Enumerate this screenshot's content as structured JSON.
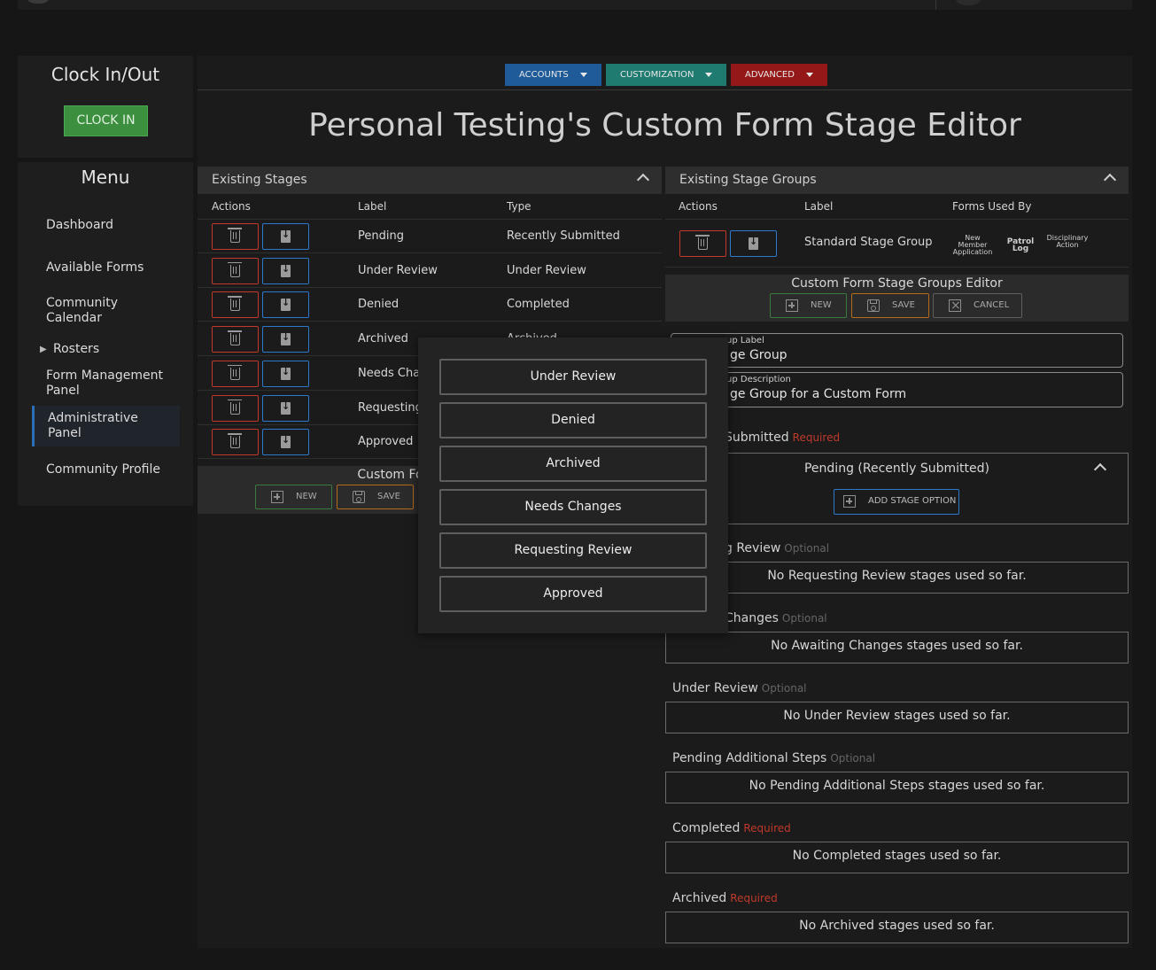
{
  "clock": {
    "title": "Clock In/Out",
    "button": "CLOCK IN"
  },
  "menu": {
    "title": "Menu",
    "items": [
      "Dashboard",
      "Available Forms",
      "Community Calendar",
      "Rosters",
      "Form Management Panel",
      "Administrative Panel",
      "Community Profile"
    ],
    "active": "Administrative Panel"
  },
  "nav": {
    "accounts": "ACCOUNTS",
    "customization": "CUSTOMIZATION",
    "advanced": "ADVANCED"
  },
  "page_title": "Personal Testing's Custom Form Stage Editor",
  "stages": {
    "title": "Existing Stages",
    "columns": [
      "Actions",
      "Label",
      "Type"
    ],
    "rows": [
      {
        "label": "Pending",
        "type": "Recently Submitted"
      },
      {
        "label": "Under Review",
        "type": "Under Review"
      },
      {
        "label": "Denied",
        "type": "Completed"
      },
      {
        "label": "Archived",
        "type": "Archived"
      },
      {
        "label": "Needs Chan",
        "type": ""
      },
      {
        "label": "Requesting",
        "type": ""
      },
      {
        "label": "Approved",
        "type": ""
      }
    ],
    "editor_title": "Custom Fo",
    "new_label": "NEW",
    "save_label": "SAVE"
  },
  "groups": {
    "title": "Existing Stage Groups",
    "columns": [
      "Actions",
      "Label",
      "Forms Used By"
    ],
    "row": {
      "label": "Standard Stage Group",
      "forms": [
        "New Member Application",
        "Patrol Log",
        "Disciplinary Action"
      ]
    },
    "editor_title": "Custom Form Stage Groups Editor",
    "new_label": "NEW",
    "save_label": "SAVE",
    "cancel_label": "CANCEL",
    "label_field": {
      "label": "up Label",
      "value": "ge Group"
    },
    "desc_field": {
      "label": "up Description",
      "value": "ge Group for a Custom Form"
    }
  },
  "stage_sections": [
    {
      "name": "Submitted",
      "tag": "Required",
      "empty": ""
    },
    {
      "name": "g Review",
      "tag": "Optional",
      "empty": "No Requesting Review stages used so far."
    },
    {
      "name": "Changes",
      "tag": "Optional",
      "empty": "No Awaiting Changes stages used so far."
    },
    {
      "name": "Under Review",
      "tag": "Optional",
      "empty": "No Under Review stages used so far."
    },
    {
      "name": "Pending Additional Steps",
      "tag": "Optional",
      "empty": "No Pending Additional Steps stages used so far."
    },
    {
      "name": "Completed",
      "tag": "Required",
      "empty": "No Completed stages used so far."
    },
    {
      "name": "Archived",
      "tag": "Required",
      "empty": "No Archived stages used so far."
    }
  ],
  "submitted_stage": {
    "label": "Pending (Recently Submitted)",
    "add_button": "ADD STAGE OPTION"
  },
  "popup_options": [
    "Under Review",
    "Denied",
    "Archived",
    "Needs Changes",
    "Requesting Review",
    "Approved"
  ],
  "colors": {
    "accounts": "#1f5b99",
    "customization": "#1f7a70",
    "advanced": "#951818",
    "required": "#c0392b",
    "clock_in": "#3b8f3e"
  }
}
